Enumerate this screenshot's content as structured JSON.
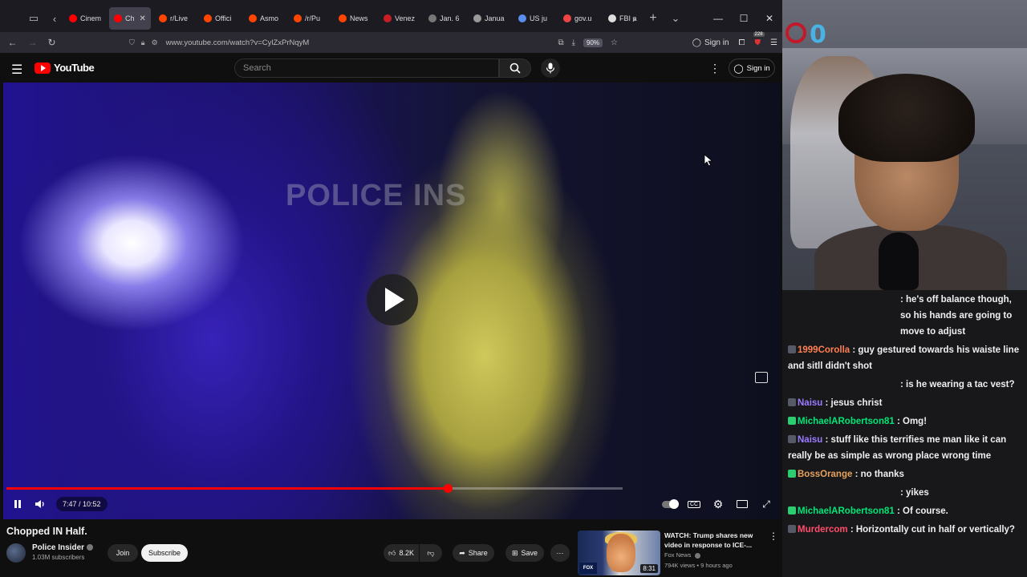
{
  "browser": {
    "tabs": [
      {
        "label": "Cinem",
        "favicon_color": "#ff0000",
        "active": false
      },
      {
        "label": "Ch",
        "favicon_color": "#ff0000",
        "active": true
      },
      {
        "label": "r/Live",
        "favicon_color": "#ff4500",
        "active": false
      },
      {
        "label": "Offici",
        "favicon_color": "#ff4500",
        "active": false
      },
      {
        "label": "Asmo",
        "favicon_color": "#ff4500",
        "active": false
      },
      {
        "label": "/r/Pu",
        "favicon_color": "#ff4500",
        "active": false
      },
      {
        "label": "News",
        "favicon_color": "#ff4500",
        "active": false
      },
      {
        "label": "Venez",
        "favicon_color": "#c81d25",
        "active": false
      },
      {
        "label": "Jan. 6",
        "favicon_color": "#777777",
        "active": false
      },
      {
        "label": "Janua",
        "favicon_color": "#999999",
        "active": false
      },
      {
        "label": "US ju",
        "favicon_color": "#5a8dee",
        "active": false
      },
      {
        "label": "gov.u",
        "favicon_color": "#e44",
        "active": false
      },
      {
        "label": "FBI a",
        "favicon_color": "#dddddd",
        "active": false
      }
    ],
    "url": "www.youtube.com/watch?v=CylZxPrNqyM",
    "zoom": "90%",
    "signin_label": "Sign in",
    "extension_badge": "228"
  },
  "youtube": {
    "logo_text": "YouTube",
    "search_placeholder": "Search",
    "signin_label": "Sign in",
    "video": {
      "watermark": "POLICE INS",
      "time_display": "7:47 / 10:52",
      "progress_fraction": 0.716,
      "buffered_fraction": 1.0
    },
    "title": "Chopped IN Half.",
    "channel": {
      "name": "Police Insider",
      "subscribers": "1.03M subscribers",
      "join_label": "Join",
      "subscribe_label": "Subscribe"
    },
    "actions": {
      "likes": "8.2K",
      "share_label": "Share",
      "save_label": "Save"
    },
    "recommended": {
      "title": "WATCH: Trump shares new video in response to ICE-...",
      "channel": "Fox News",
      "meta": "794K views • 9 hours ago",
      "duration": "8:31",
      "thumb_logo": "FOX"
    }
  },
  "stream": {
    "chat": [
      {
        "user": "",
        "user_color": "#efeff1",
        "text": ": he's off balance though, so his hands are going to move to adjust",
        "indent": true
      },
      {
        "user": "1999Corolla",
        "user_color": "#ff7f50",
        "text": " : guy gestured towards his waiste line and sitll didn't shot",
        "indent": false
      },
      {
        "user": "",
        "user_color": "#efeff1",
        "text": ": is he wearing a tac vest?",
        "indent": true
      },
      {
        "user": "Naisu",
        "user_color": "#9b7bff",
        "text": " : jesus christ",
        "indent": false
      },
      {
        "user": "MichaelARobertson81",
        "user_color": "#00e676",
        "text": " : Omg!",
        "indent": false
      },
      {
        "user": "Naisu",
        "user_color": "#9b7bff",
        "text": " : stuff like this terrifies me man like it can really be as simple as wrong place wrong time",
        "indent": false
      },
      {
        "user": "BossOrange",
        "user_color": "#e6a15c",
        "text": " : no thanks",
        "indent": false
      },
      {
        "user": "",
        "user_color": "#efeff1",
        "text": ": yikes",
        "indent": true
      },
      {
        "user": "MichaelARobertson81",
        "user_color": "#00e676",
        "text": " : Of course.",
        "indent": false
      },
      {
        "user": "Murdercom",
        "user_color": "#ff4d6a",
        "text": " : Horizontally cut in half or vertically?",
        "indent": false
      }
    ]
  },
  "colors": {
    "yt_red": "#ff0000",
    "page_bg": "#0f0f0f",
    "chat_bg": "#18181b"
  }
}
